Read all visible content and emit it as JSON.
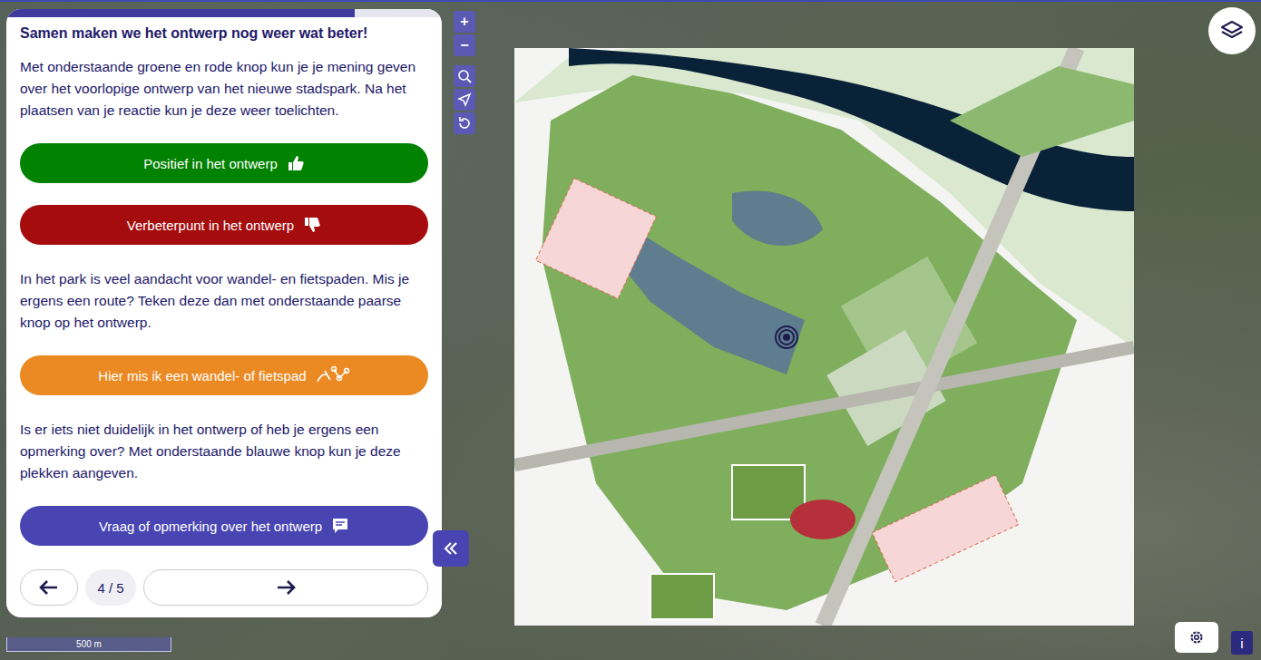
{
  "panel": {
    "progress": {
      "level": 0.8
    },
    "heading": "Samen maken we het ontwerp nog weer wat beter!",
    "sections": [
      {
        "text": "Met onderstaande groene en rode knop kun je je mening geven over het voorlopige ontwerp van het nieuwe stadspark. Na het plaatsen van je reactie kun je deze weer toelichten.",
        "buttons": [
          {
            "label": "Positief in het ontwerp",
            "kind": "positive",
            "color": "#018201"
          },
          {
            "label": "Verbeterpunt in het ontwerp",
            "kind": "negative",
            "color": "#a50c0e"
          }
        ]
      },
      {
        "text": "In het park is veel aandacht voor wandel- en fietspaden. Mis je ergens een route? Teken deze dan met onderstaande paarse knop op het ontwerp.",
        "buttons": [
          {
            "label": "Hier mis ik een wandel- of fietspad",
            "kind": "route",
            "color": "#eb8a23"
          }
        ]
      },
      {
        "text": "Is er iets niet duidelijk in het ontwerp of heb je ergens een opmerking over? Met onderstaande blauwe knop kun je deze plekken aangeven.",
        "buttons": [
          {
            "label": "Vraag of opmerking over het ontwerp",
            "kind": "comment",
            "color": "#4845b3"
          }
        ]
      }
    ],
    "pager": {
      "page": "4 / 5"
    }
  },
  "map_controls": [
    {
      "label": "+",
      "kind": "text"
    },
    {
      "label": "−",
      "kind": "text"
    },
    {
      "label": "",
      "kind": "search"
    },
    {
      "label": "",
      "kind": "locate"
    },
    {
      "label": "",
      "kind": "reset"
    }
  ],
  "scale": "500 m",
  "info": "i"
}
